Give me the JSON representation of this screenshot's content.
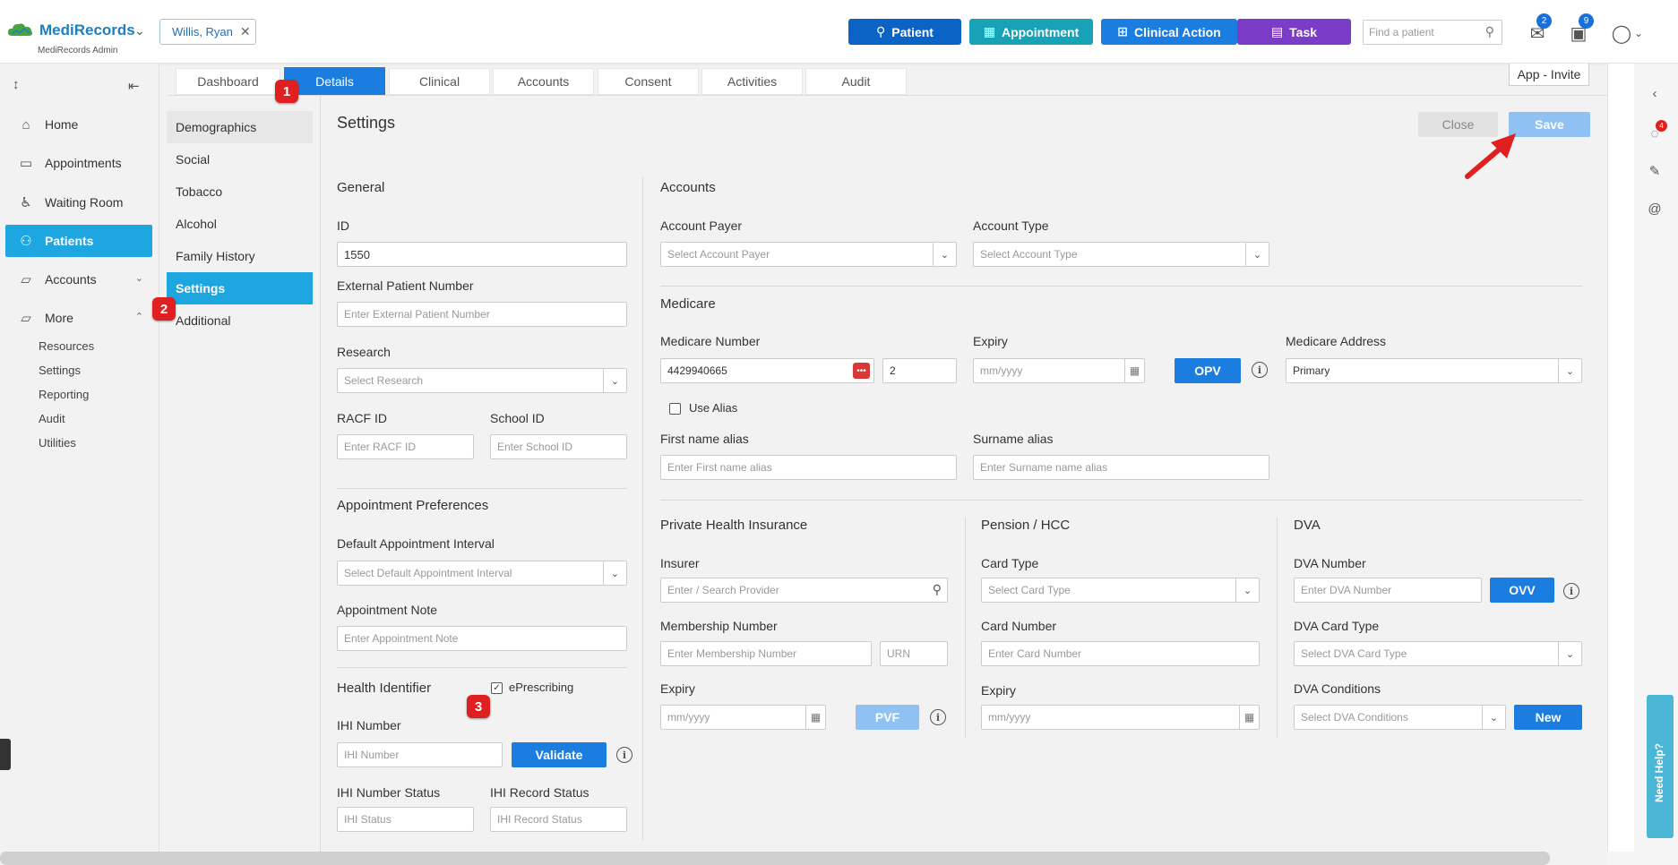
{
  "header": {
    "brand": "MediRecords",
    "brand_sub": "MediRecords Admin",
    "patient_chip": "Willis, Ryan",
    "buttons": [
      {
        "label": "Patient",
        "color": "#0b63c5"
      },
      {
        "label": "Appointment",
        "color": "#18a2b8"
      },
      {
        "label": "Clinical Action",
        "color": "#1b7de0"
      },
      {
        "label": "Task",
        "color": "#7b3cc7"
      }
    ],
    "search_placeholder": "Find a patient",
    "mail_badge": "2",
    "tasks_badge": "9"
  },
  "sidebar": {
    "items": [
      {
        "label": "Home",
        "icon": "home-icon"
      },
      {
        "label": "Appointments",
        "icon": "calendar-icon"
      },
      {
        "label": "Waiting Room",
        "icon": "waiting-room-icon"
      },
      {
        "label": "Patients",
        "icon": "patients-icon"
      },
      {
        "label": "Accounts",
        "icon": "folder-icon"
      },
      {
        "label": "More",
        "icon": "folder-plus-icon"
      }
    ],
    "sub_items": [
      "Resources",
      "Settings",
      "Reporting",
      "Audit",
      "Utilities"
    ]
  },
  "tabs": [
    "Dashboard",
    "Details",
    "Clinical",
    "Accounts",
    "Consent",
    "Activities",
    "Audit"
  ],
  "app_invite": "App - Invite",
  "submenu": [
    "Demographics",
    "Social",
    "Tobacco",
    "Alcohol",
    "Family History",
    "Settings",
    "Additional"
  ],
  "markers": [
    "1",
    "2",
    "3"
  ],
  "main": {
    "title": "Settings",
    "close_label": "Close",
    "save_label": "Save",
    "general": {
      "title": "General",
      "id_label": "ID",
      "id_value": "1550",
      "external_label": "External Patient Number",
      "external_ph": "Enter External Patient Number",
      "research_label": "Research",
      "research_ph": "Select Research",
      "racf_label": "RACF ID",
      "racf_ph": "Enter RACF ID",
      "school_label": "School ID",
      "school_ph": "Enter School ID"
    },
    "appointment": {
      "title": "Appointment Preferences",
      "interval_label": "Default Appointment Interval",
      "interval_ph": "Select Default Appointment Interval",
      "note_label": "Appointment Note",
      "note_ph": "Enter Appointment Note"
    },
    "health": {
      "title": "Health Identifier",
      "eprescribing": "ePrescribing",
      "ihi_label": "IHI Number",
      "ihi_ph": "IHI Number",
      "validate": "Validate",
      "ihi_status_label": "IHI Number Status",
      "ihi_status_ph": "IHI Status",
      "ihi_record_label": "IHI Record Status",
      "ihi_record_ph": "IHI Record Status"
    },
    "accounts": {
      "title": "Accounts",
      "payer_label": "Account Payer",
      "payer_ph": "Select Account Payer",
      "type_label": "Account Type",
      "type_ph": "Select Account Type"
    },
    "medicare": {
      "title": "Medicare",
      "number_label": "Medicare Number",
      "number_value": "4429940665",
      "irn_value": "2",
      "expiry_label": "Expiry",
      "expiry_ph": "mm/yyyy",
      "opv": "OPV",
      "address_label": "Medicare Address",
      "address_value": "Primary",
      "use_alias": "Use Alias",
      "first_alias_label": "First name alias",
      "first_alias_ph": "Enter First name alias",
      "surname_alias_label": "Surname alias",
      "surname_alias_ph": "Enter Surname name alias"
    },
    "phi": {
      "title": "Private Health Insurance",
      "insurer_label": "Insurer",
      "insurer_ph": "Enter / Search Provider",
      "membership_label": "Membership Number",
      "membership_ph": "Enter Membership Number",
      "urn_ph": "URN",
      "expiry_label": "Expiry",
      "expiry_ph": "mm/yyyy",
      "pvf": "PVF"
    },
    "pension": {
      "title": "Pension / HCC",
      "card_type_label": "Card Type",
      "card_type_ph": "Select Card Type",
      "card_number_label": "Card Number",
      "card_number_ph": "Enter Card Number",
      "expiry_label": "Expiry",
      "expiry_ph": "mm/yyyy"
    },
    "dva": {
      "title": "DVA",
      "number_label": "DVA Number",
      "number_ph": "Enter DVA Number",
      "ovv": "OVV",
      "card_type_label": "DVA Card Type",
      "card_type_ph": "Select DVA Card Type",
      "conditions_label": "DVA Conditions",
      "conditions_ph": "Select DVA Conditions",
      "new": "New"
    }
  },
  "right_rail": {
    "notif_badge": "4",
    "need_help": "Need Help?"
  }
}
